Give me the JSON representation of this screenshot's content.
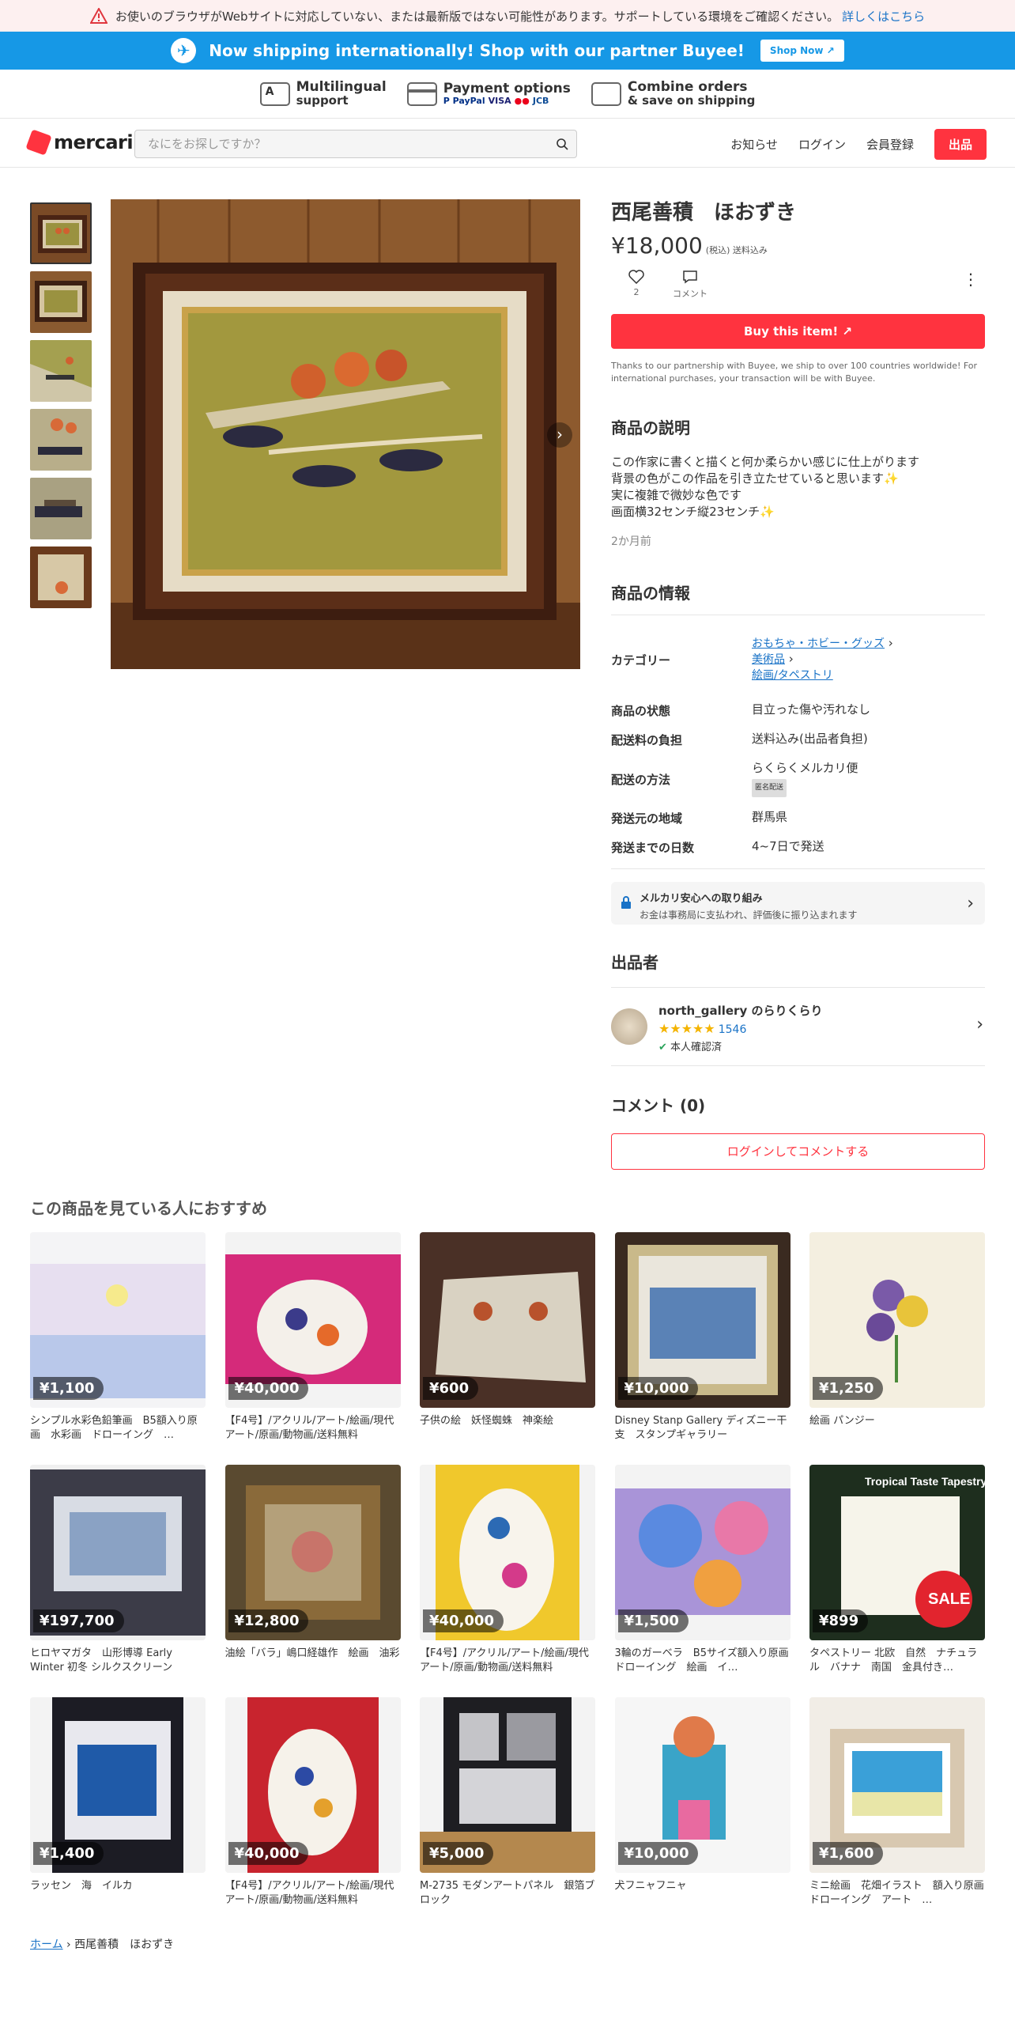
{
  "banner": {
    "warning_text": "お使いのブラウザがWebサイトに対応していない、または最新版ではない可能性があります。サポートしている環境をご確認ください。",
    "warning_link": "詳しくはこちら"
  },
  "shipping_banner": {
    "text": "Now shipping internationally! Shop with our partner Buyee!",
    "button": "Shop Now"
  },
  "features": [
    {
      "line1": "Multilingual",
      "line2": "support",
      "icon": "translate-icon"
    },
    {
      "line1": "Payment options",
      "line2": "PayPal VISA",
      "icon": "card-icon"
    },
    {
      "line1": "Combine orders",
      "line2": "& save on shipping",
      "icon": "box-icon"
    }
  ],
  "header": {
    "logo": "mercari",
    "search_placeholder": "なにをお探しですか？",
    "nav": [
      "お知らせ",
      "ログイン",
      "会員登録"
    ],
    "sell": "出品"
  },
  "item": {
    "title": "西尾善積　ほおずき",
    "price": "¥18,000",
    "price_note": "(税込) 送料込み",
    "likes": "2",
    "comment_label": "コメント",
    "buy_button": "Buy this item!",
    "partner_note": "Thanks to our partnership with Buyee, we ship to over 100 countries worldwide! For international purchases, your transaction will be with Buyee.",
    "desc_heading": "商品の説明",
    "description": [
      "この作家に書くと描くと何か柔らかい感じに仕上がります",
      "背景の色がこの作品を引き立たせていると思います✨",
      "実に複雑で微妙な色です",
      "画面横32センチ縦23センチ✨"
    ],
    "posted": "2か月前",
    "info_heading": "商品の情報",
    "info": {
      "category_label": "カテゴリー",
      "categories": [
        "おもちゃ・ホビー・グッズ",
        "美術品",
        "絵画/タペストリ"
      ],
      "condition_label": "商品の状態",
      "condition": "目立った傷や汚れなし",
      "shipping_fee_label": "配送料の負担",
      "shipping_fee": "送料込み(出品者負担)",
      "method_label": "配送の方法",
      "method": "らくらくメルカリ便",
      "method_badge": "匿名配送",
      "origin_label": "発送元の地域",
      "origin": "群馬県",
      "days_label": "発送までの日数",
      "days": "4~7日で発送"
    },
    "safe": {
      "title": "メルカリ安心への取り組み",
      "text": "お金は事務局に支払われ、評価後に振り込まれます"
    },
    "seller_heading": "出品者",
    "seller": {
      "name": "north_gallery のらりくらり",
      "stars": "★★★★★",
      "rating_count": "1546",
      "verified": "本人確認済"
    },
    "comments_heading": "コメント (0)",
    "comment_button": "ログインしてコメントする"
  },
  "recommend_heading": "この商品を見ている人におすすめ",
  "recommendations": [
    {
      "price": "¥1,100",
      "name": "シンプル水彩色鉛筆画　B5額入り原画　水彩画　ドローイング　…"
    },
    {
      "price": "¥40,000",
      "name": "【F4号】/アクリル/アート/絵画/現代アート/原画/動物画/送料無料"
    },
    {
      "price": "¥600",
      "name": "子供の絵　妖怪蜘蛛　神楽絵"
    },
    {
      "price": "¥10,000",
      "name": "Disney Stanp Gallery ディズニー干支　スタンプギャラリー"
    },
    {
      "price": "¥1,250",
      "name": "絵画 パンジー"
    },
    {
      "price": "¥197,700",
      "name": "ヒロヤマガタ　山形博導 Early Winter 初冬 シルクスクリーン"
    },
    {
      "price": "¥12,800",
      "name": "油絵「バラ」嶋口経雄作　絵画　油彩"
    },
    {
      "price": "¥40,000",
      "name": "【F4号】/アクリル/アート/絵画/現代アート/原画/動物画/送料無料"
    },
    {
      "price": "¥1,500",
      "name": "3輪のガーベラ　B5サイズ額入り原画　ドローイング　絵画　イ…"
    },
    {
      "price": "¥899",
      "name": "タペストリー 北欧　自然　ナチュラル　バナナ　南国　金具付き…"
    },
    {
      "price": "¥1,400",
      "name": "ラッセン　海　イルカ"
    },
    {
      "price": "¥40,000",
      "name": "【F4号】/アクリル/アート/絵画/現代アート/原画/動物画/送料無料"
    },
    {
      "price": "¥5,000",
      "name": "M-2735 モダンアートパネル　銀箔ブロック"
    },
    {
      "price": "¥10,000",
      "name": "犬フニャフニャ"
    },
    {
      "price": "¥1,600",
      "name": "ミニ絵画　花畑イラスト　額入り原画　ドローイング　アート　…"
    }
  ],
  "breadcrumb": {
    "home": "ホーム",
    "current": "西尾善積　ほおずき"
  },
  "colors": {
    "accent": "#ff333f",
    "link": "#1a73c7",
    "banner": "#1698e6"
  }
}
